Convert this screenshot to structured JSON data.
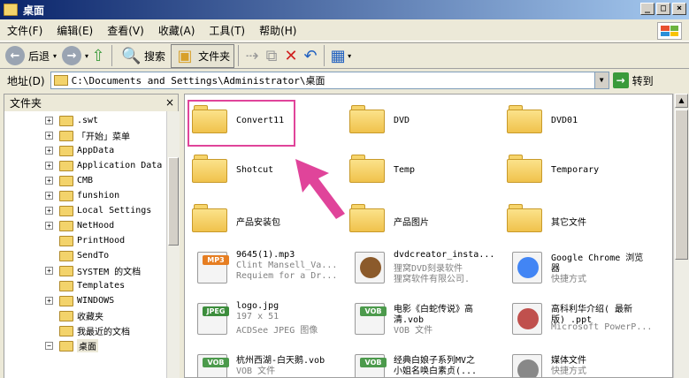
{
  "window": {
    "title": "桌面",
    "min": "_",
    "max": "□",
    "close": "×"
  },
  "menu": [
    "文件(F)",
    "编辑(E)",
    "查看(V)",
    "收藏(A)",
    "工具(T)",
    "帮助(H)"
  ],
  "toolbar": {
    "back": "后退",
    "search": "搜索",
    "folders": "文件夹"
  },
  "address": {
    "label": "地址(D)",
    "path": "C:\\Documents and Settings\\Administrator\\桌面",
    "go": "转到"
  },
  "folder_pane": {
    "title": "文件夹",
    "close": "×"
  },
  "tree": [
    {
      "label": ".swt",
      "plus": true
    },
    {
      "label": "「开始」菜单",
      "plus": true
    },
    {
      "label": "AppData",
      "plus": true
    },
    {
      "label": "Application Data",
      "plus": true
    },
    {
      "label": "CMB",
      "plus": true
    },
    {
      "label": "funshion",
      "plus": true
    },
    {
      "label": "Local Settings",
      "plus": true
    },
    {
      "label": "NetHood",
      "plus": true
    },
    {
      "label": "PrintHood",
      "plus": false
    },
    {
      "label": "SendTo",
      "plus": false
    },
    {
      "label": "SYSTEM 的文档",
      "plus": true
    },
    {
      "label": "Templates",
      "plus": false
    },
    {
      "label": "WINDOWS",
      "plus": true
    },
    {
      "label": "收藏夹",
      "plus": false
    },
    {
      "label": "我最近的文档",
      "plus": false
    },
    {
      "label": "桌面",
      "plus": true,
      "minus": true,
      "selected": true
    }
  ],
  "items": {
    "folders": [
      {
        "name": "Convert11"
      },
      {
        "name": "DVD"
      },
      {
        "name": "DVD01"
      },
      {
        "name": "Shotcut"
      },
      {
        "name": "Temp"
      },
      {
        "name": "Temporary"
      },
      {
        "name": "产品安装包"
      },
      {
        "name": "产品图片"
      },
      {
        "name": "其它文件"
      }
    ],
    "files": [
      {
        "l1": "9645(1).mp3",
        "l2": "Clint Mansell_Va...",
        "l3": "Requiem for a Dr...",
        "badge": "MP3",
        "color": "#e67e22"
      },
      {
        "l1": "dvdcreator_insta...",
        "l2": "狸窝DVD刻录软件",
        "l3": "狸窝软件有限公司.",
        "badge": "",
        "color": "#8b5a2b"
      },
      {
        "l1": "Google Chrome 浏览",
        "l2": "器",
        "l3": "快捷方式",
        "badge": "",
        "color": "#4285f4"
      },
      {
        "l1": "logo.jpg",
        "l2": "197 x 51",
        "l3": "ACDSee JPEG 图像",
        "badge": "JPEG",
        "color": "#3c8d3c"
      },
      {
        "l1": "电影《白蛇传说》高",
        "l2": "清.vob",
        "l3": "VOB 文件",
        "badge": "VOB",
        "color": "#4c9a4c"
      },
      {
        "l1": "高科利华介绍( 最新",
        "l2": "版) .ppt",
        "l3": "Microsoft PowerP...",
        "badge": "",
        "color": "#c0504d"
      },
      {
        "l1": "杭州西湖-白天鹅.vob",
        "l2": "VOB 文件",
        "l3": "",
        "badge": "VOB",
        "color": "#4c9a4c"
      },
      {
        "l1": "经典白娘子系列MV之",
        "l2": "小姐名唤白素贞(...",
        "l3": "",
        "badge": "VOB",
        "color": "#4c9a4c"
      },
      {
        "l1": "媒体文件",
        "l2": "快捷方式",
        "l3": "",
        "badge": "",
        "color": "#888888"
      }
    ]
  },
  "colors": {
    "highlight": "#e0449a"
  }
}
